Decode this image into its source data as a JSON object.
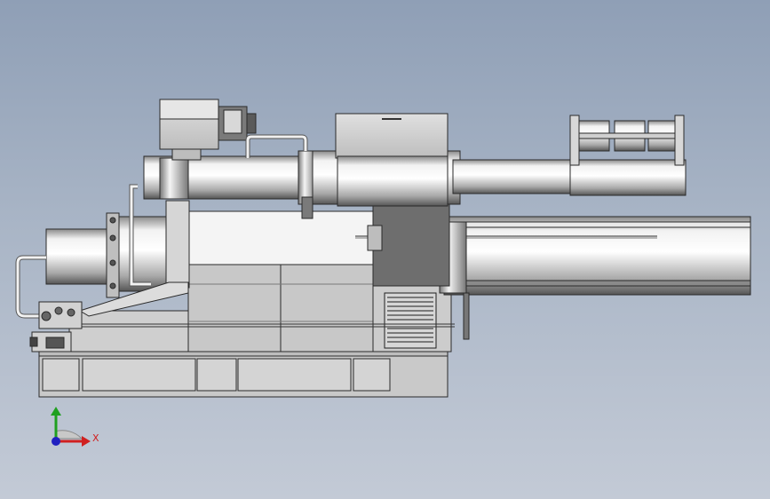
{
  "viewport": {
    "background_top": "#8f9fb6",
    "background_bottom": "#c3cad6"
  },
  "triad": {
    "x_label": "X",
    "x_color": "#d02020",
    "y_color": "#20a020",
    "z_color": "#2020c0"
  },
  "model": {
    "body_fill": "#cfcfcf",
    "light_fill": "#f4f4f4",
    "dark_fill": "#6e6e6e",
    "outline": "#2a2a2a"
  }
}
